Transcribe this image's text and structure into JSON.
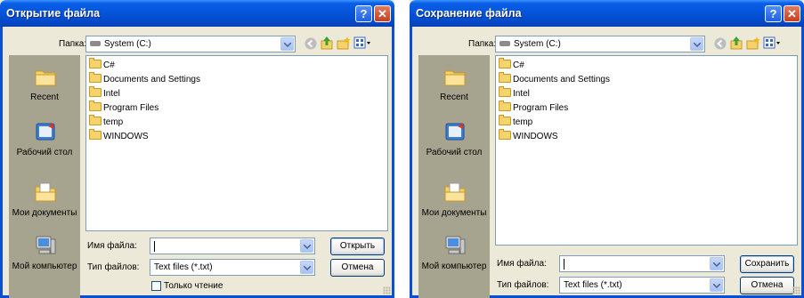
{
  "open_dialog": {
    "title": "Открытие файла",
    "help_glyph": "?",
    "close_glyph": "✕",
    "folder_label": "Папка:",
    "folder_value": "System (C:)",
    "places": [
      "Recent",
      "Рабочий стол",
      "Мои документы",
      "Мой компьютер"
    ],
    "files": [
      "C#",
      "Documents and Settings",
      "Intel",
      "Program Files",
      "temp",
      "WINDOWS"
    ],
    "filename_label": "Имя файла:",
    "filename_value": "",
    "filetype_label": "Тип файлов:",
    "filetype_value": "Text files (*.txt)",
    "readonly_label": "Только чтение",
    "open_button": "Открыть",
    "cancel_button": "Отмена"
  },
  "save_dialog": {
    "title": "Сохранение файла",
    "help_glyph": "?",
    "close_glyph": "✕",
    "folder_label": "Папка:",
    "folder_value": "System (C:)",
    "places": [
      "Recent",
      "Рабочий стол",
      "Мои документы",
      "Мой компьютер"
    ],
    "files": [
      "C#",
      "Documents and Settings",
      "Intel",
      "Program Files",
      "temp",
      "WINDOWS"
    ],
    "filename_label": "Имя файла:",
    "filename_value": "",
    "filetype_label": "Тип файлов:",
    "filetype_value": "Text files (*.txt)",
    "save_button": "Сохранить",
    "cancel_button": "Отмена"
  },
  "icons": {
    "back": "back-arrow-icon",
    "up": "up-folder-icon",
    "new_folder": "new-folder-icon",
    "views": "views-menu-icon"
  },
  "colors": {
    "titlebar": "#0553d8",
    "dialog_face": "#ece9d8",
    "places_bar": "#a6a38f",
    "close_button": "#c5401f"
  }
}
